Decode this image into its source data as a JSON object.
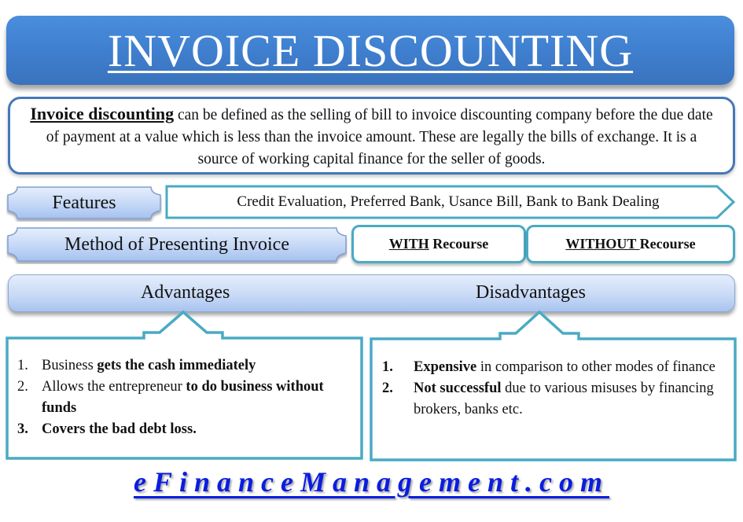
{
  "title": "INVOICE DISCOUNTING",
  "definition": {
    "term": "Invoice discounting",
    "text": " can be defined as the selling of bill to invoice discounting company before the due date of payment at a value which is less than the invoice amount. These are legally the bills of exchange. It is a source of working capital finance for the seller of goods."
  },
  "features": {
    "label": "Features",
    "value": "Credit Evaluation, Preferred Bank, Usance Bill, Bank to Bank Dealing"
  },
  "method": {
    "label": "Method of Presenting Invoice",
    "options": [
      {
        "underlined": "WITH",
        "rest": " Recourse"
      },
      {
        "underlined": "WITHOUT ",
        "rest": "Recourse"
      }
    ]
  },
  "advantages": {
    "heading": "Advantages",
    "items": [
      {
        "num": "1.",
        "plain": "Business ",
        "bold": "gets the cash immediately",
        "tail": ""
      },
      {
        "num": "2.",
        "plain": "Allows the entrepreneur ",
        "bold": "to do business without funds",
        "tail": ""
      },
      {
        "num": "3.",
        "plain": "",
        "bold": "Covers the bad debt loss.",
        "tail": ""
      }
    ]
  },
  "disadvantages": {
    "heading": "Disadvantages",
    "items": [
      {
        "num": "1.",
        "plain": "",
        "bold": "Expensive",
        "tail": " in comparison to other modes of finance"
      },
      {
        "num": "2.",
        "plain": "",
        "bold": "Not successful",
        "tail": " due to various misuses by financing brokers, banks etc."
      }
    ]
  },
  "footer": {
    "link": "eFinanceManagement.com"
  },
  "colors": {
    "title_blue": "#3f7fcf",
    "teal_border": "#4aaac4",
    "definition_border": "#4478b8",
    "plaque_light": "#c3d6f5",
    "footer_blue": "#0a1de0"
  }
}
